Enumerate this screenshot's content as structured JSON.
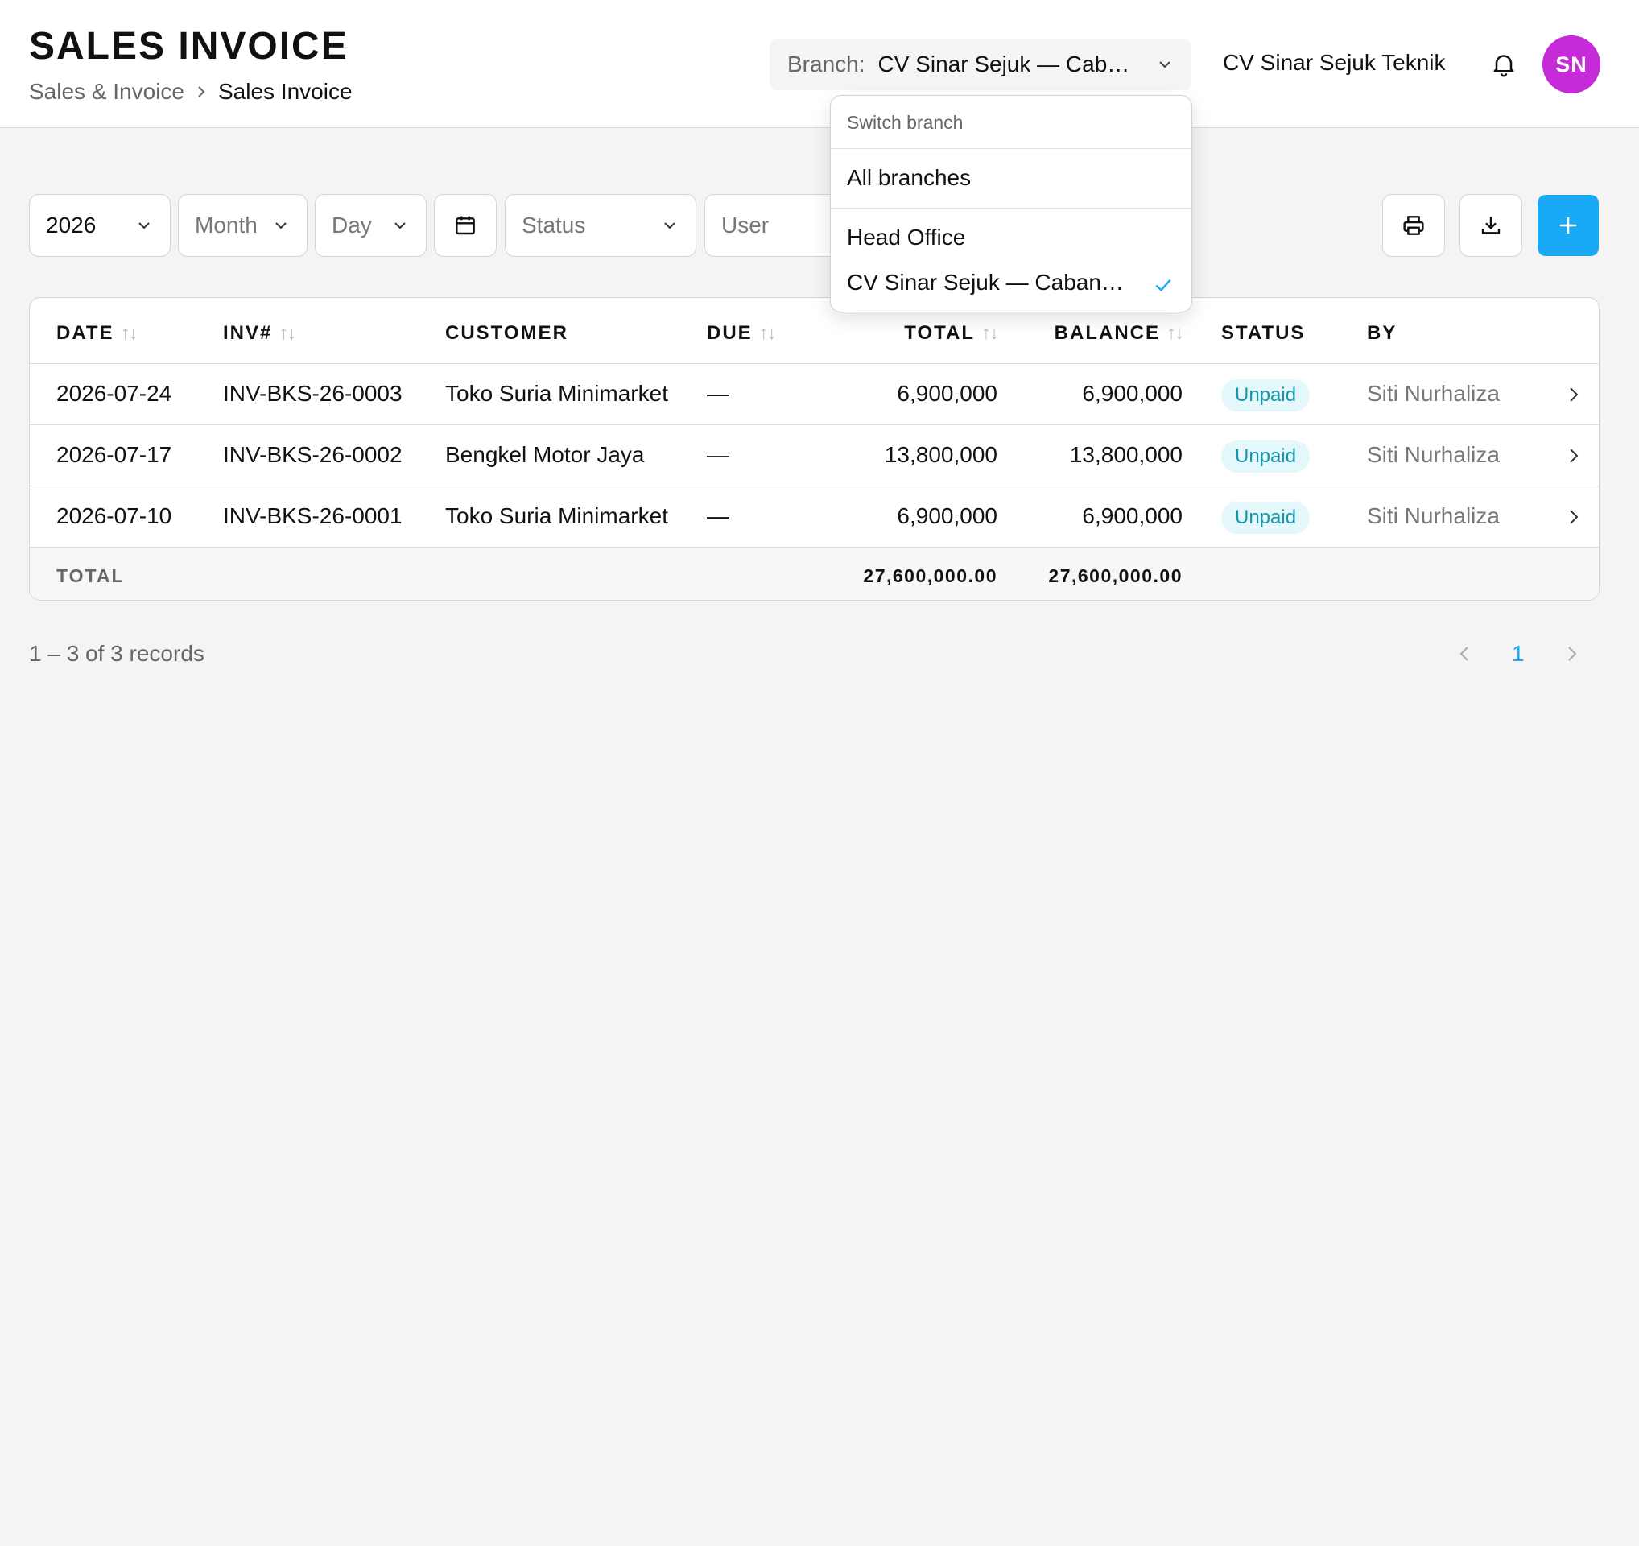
{
  "header": {
    "title": "SALES INVOICE",
    "breadcrumb": {
      "parent": "Sales & Invoice",
      "current": "Sales Invoice"
    },
    "branch": {
      "label": "Branch:",
      "value": "CV Sinar Sejuk — Cab…"
    },
    "company": "CV Sinar Sejuk Teknik",
    "avatar_initials": "SN"
  },
  "branch_dropdown": {
    "title": "Switch branch",
    "all_label": "All branches",
    "items": [
      {
        "label": "Head Office",
        "selected": false
      },
      {
        "label": "CV Sinar Sejuk — Caban…",
        "selected": true
      }
    ]
  },
  "filters": {
    "year": "2026",
    "month_placeholder": "Month",
    "day_placeholder": "Day",
    "status_placeholder": "Status",
    "user_placeholder": "User"
  },
  "table": {
    "columns": [
      "DATE",
      "INV#",
      "CUSTOMER",
      "DUE",
      "TOTAL",
      "BALANCE",
      "STATUS",
      "BY"
    ],
    "rows": [
      {
        "date": "2026-07-24",
        "inv": "INV-BKS-26-0003",
        "customer": "Toko Suria Minimarket",
        "due": "—",
        "total": "6,900,000",
        "balance": "6,900,000",
        "status": "Unpaid",
        "by": "Siti Nurhaliza"
      },
      {
        "date": "2026-07-17",
        "inv": "INV-BKS-26-0002",
        "customer": "Bengkel Motor Jaya",
        "due": "—",
        "total": "13,800,000",
        "balance": "13,800,000",
        "status": "Unpaid",
        "by": "Siti Nurhaliza"
      },
      {
        "date": "2026-07-10",
        "inv": "INV-BKS-26-0001",
        "customer": "Toko Suria Minimarket",
        "due": "—",
        "total": "6,900,000",
        "balance": "6,900,000",
        "status": "Unpaid",
        "by": "Siti Nurhaliza"
      }
    ],
    "footer": {
      "label": "TOTAL",
      "total": "27,600,000.00",
      "balance": "27,600,000.00"
    }
  },
  "pagination": {
    "records_text": "1 – 3 of 3 records",
    "current_page": "1"
  },
  "colors": {
    "accent": "#1aa9f5",
    "avatar_bg": "#c62bd8",
    "badge_bg": "#e4f7fa",
    "badge_text": "#1597ad"
  },
  "icons": [
    "chevron-right-icon",
    "chevron-down-icon",
    "bell-icon",
    "calendar-icon",
    "printer-icon",
    "download-icon",
    "plus-icon",
    "check-icon",
    "chevron-left-icon"
  ]
}
